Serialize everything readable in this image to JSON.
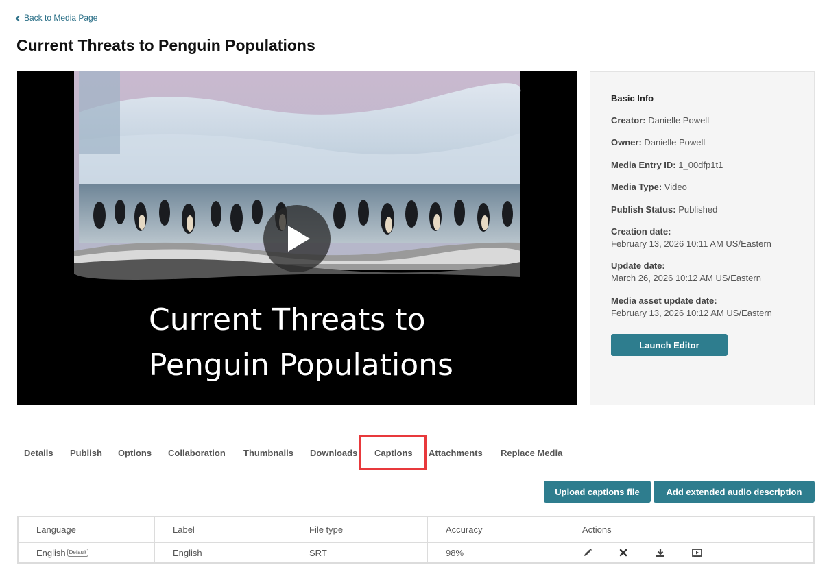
{
  "nav": {
    "back_label": "Back to Media Page"
  },
  "page": {
    "title": "Current Threats to Penguin Populations"
  },
  "player": {
    "video_title_text": "Current Threats to\nPenguin Populations"
  },
  "info": {
    "heading": "Basic Info",
    "creator_label": "Creator:",
    "creator": "Danielle Powell",
    "owner_label": "Owner:",
    "owner": "Danielle Powell",
    "entry_id_label": "Media Entry ID:",
    "entry_id": "1_00dfp1t1",
    "media_type_label": "Media Type:",
    "media_type": "Video",
    "publish_status_label": "Publish Status:",
    "publish_status": "Published",
    "creation_label": "Creation date:",
    "creation_date": "February 13, 2026 10:11 AM US/Eastern",
    "update_label": "Update date:",
    "update_date": "March 26, 2026 10:12 AM US/Eastern",
    "asset_update_label": "Media asset update date:",
    "asset_update_date": "February 13, 2026 10:12 AM US/Eastern",
    "launch_editor_label": "Launch Editor"
  },
  "tabs": [
    "Details",
    "Publish",
    "Options",
    "Collaboration",
    "Thumbnails",
    "Downloads",
    "Captions",
    "Attachments",
    "Replace Media"
  ],
  "active_tab": "Captions",
  "captions": {
    "upload_label": "Upload captions file",
    "add_audio_desc_label": "Add extended audio description",
    "columns": [
      "Language",
      "Label",
      "File type",
      "Accuracy",
      "Actions"
    ],
    "rows": [
      {
        "language": "English",
        "default_badge": "Default",
        "label": "English",
        "file_type": "SRT",
        "accuracy": "98%"
      }
    ],
    "action_icons": [
      "edit-icon",
      "delete-icon",
      "download-icon",
      "preview-icon"
    ]
  },
  "colors": {
    "accent": "#2e7d8e",
    "highlight": "#e8393c",
    "link": "#2a6f87"
  }
}
